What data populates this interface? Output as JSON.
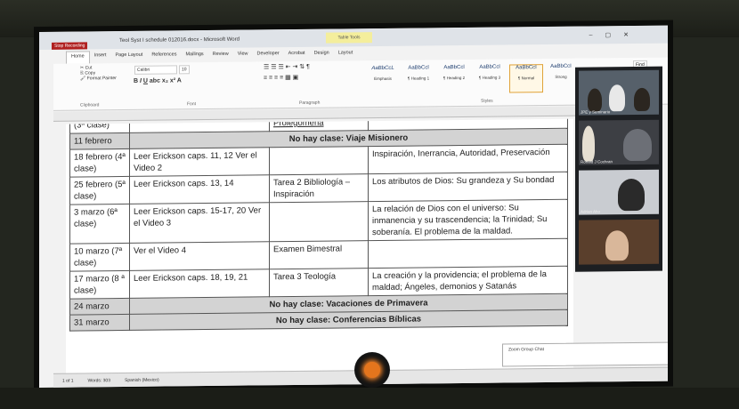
{
  "window": {
    "title": "Teol Syst I schedule 012016.docx - Microsoft Word",
    "stop_recording": "Stop Recording",
    "context_tab": "Table Tools",
    "tabs": [
      "Home",
      "Insert",
      "Page Layout",
      "References",
      "Mailings",
      "Review",
      "View",
      "Developer",
      "Acrobat",
      "Design",
      "Layout"
    ]
  },
  "ribbon": {
    "clipboard": {
      "cut": "Cut",
      "copy": "Copy",
      "format_painter": "Format Painter",
      "label": "Clipboard"
    },
    "font": {
      "name": "Calibri",
      "size": "10",
      "label": "Font"
    },
    "paragraph": {
      "label": "Paragraph"
    },
    "styles": {
      "label": "Styles",
      "items": [
        {
          "preview": "AaBbCcL",
          "name": "Emphasis"
        },
        {
          "preview": "AaBbCcl",
          "name": "¶ Heading 1"
        },
        {
          "preview": "AaBbCcl",
          "name": "¶ Heading 2"
        },
        {
          "preview": "AaBbCcl",
          "name": "¶ Heading 3"
        },
        {
          "preview": "AaBbCcI",
          "name": "¶ Normal"
        },
        {
          "preview": "AaBbCcI",
          "name": "Strong"
        },
        {
          "preview": "AaBbCcI",
          "name": "Subtitle"
        }
      ]
    },
    "find": "Find"
  },
  "table": {
    "rows": [
      {
        "type": "class",
        "date": "(3ª clase)",
        "reading": "",
        "task": "Prolegómena",
        "topic": ""
      },
      {
        "type": "noclass",
        "date": "11 febrero",
        "text": "No hay clase: Viaje Misionero"
      },
      {
        "type": "class",
        "date": "18 febrero (4ª clase)",
        "reading": "Leer Erickson caps. 11, 12 Ver el Video 2",
        "task": "",
        "topic": "Inspiración, Inerrancia, Autoridad, Preservación"
      },
      {
        "type": "class",
        "date": "25 febrero (5ª clase)",
        "reading": "Leer Erickson caps. 13, 14",
        "task": "Tarea 2 Bibliología – Inspiración",
        "topic": "Los atributos de Dios: Su grandeza y Su bondad"
      },
      {
        "type": "class",
        "date": "3 marzo (6ª clase)",
        "reading": "Leer Erickson caps. 15-17, 20 Ver el Video 3",
        "task": "",
        "topic": "La relación de Dios con el universo: Su inmanencia y su trascendencia; la Trinidad; Su soberanía. El problema de la maldad."
      },
      {
        "type": "class",
        "date": "10 marzo (7ª clase)",
        "reading": "Ver el Video 4",
        "task": "Examen Bimestral",
        "topic": ""
      },
      {
        "type": "class",
        "date": "17 marzo (8 ª clase)",
        "reading": "Leer Erickson caps. 18, 19, 21",
        "task": "Tarea 3 Teología",
        "topic": "La creación y la providencia; el problema de la maldad; Ángeles, demonios y Satanás"
      },
      {
        "type": "noclass",
        "date": "24 marzo",
        "text": "No hay clase: Vacaciones de Primavera"
      },
      {
        "type": "noclass",
        "date": "31 marzo",
        "text": "No hay clase: Conferencias Bíblicas"
      }
    ]
  },
  "status": {
    "page": "1 of 1",
    "words": "Words: 303",
    "language": "Spanish (Mexico)"
  },
  "zoom": {
    "participants": [
      "JPE y Seminario",
      "Ronald J Cochran",
      "Adrian Aho",
      ""
    ],
    "chat_title": "Zoom Group Chat"
  }
}
